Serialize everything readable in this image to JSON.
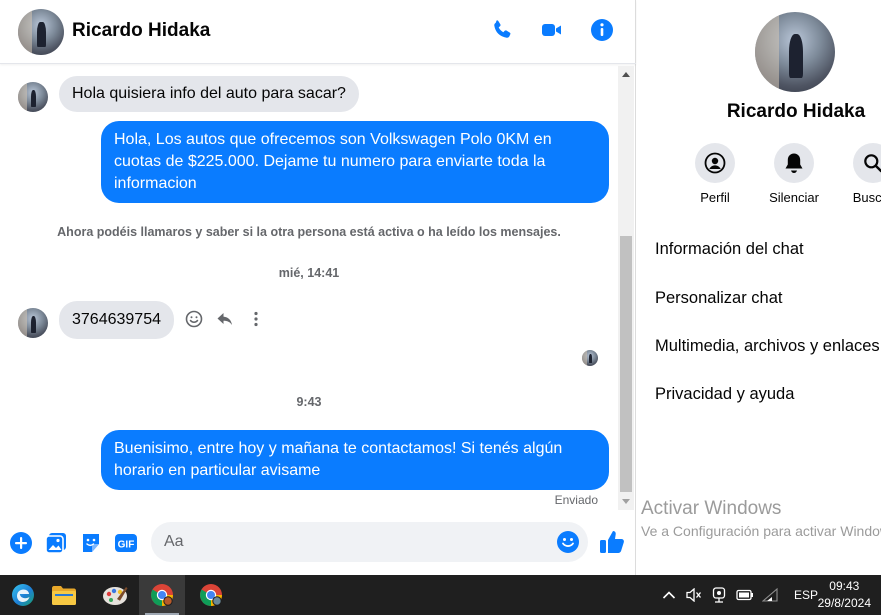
{
  "header": {
    "contact_name": "Ricardo Hidaka",
    "icons": [
      "phone-icon",
      "video-camera-icon",
      "info-icon"
    ]
  },
  "messages": {
    "incoming_1": "Hola quisiera info del auto para sacar?",
    "outgoing_1": "Hola, Los autos que ofrecemos son Volkswagen Polo 0KM en cuotas de $225.000. Dejame tu numero para enviarte toda la informacion",
    "system_notice": "Ahora podéis llamaros y saber si la otra persona está activa o ha leído los mensajes.",
    "timestamp_1": "mié, 14:41",
    "incoming_2": "3764639754",
    "timestamp_2": "9:43",
    "outgoing_2": "Buenisimo, entre hoy y mañana te contactamos! Si tenés algún horario en particular avisame",
    "status": "Enviado"
  },
  "composer": {
    "placeholder": "Aa",
    "icons": [
      "plus-icon",
      "image-icon",
      "sticker-icon",
      "gif-icon",
      "emoji-icon",
      "thumbs-up-icon"
    ],
    "gif_label": "GIF"
  },
  "panel": {
    "name": "Ricardo Hidaka",
    "buttons": [
      {
        "label": "Perfil",
        "icon": "profile-icon"
      },
      {
        "label": "Silenciar",
        "icon": "bell-icon"
      },
      {
        "label": "Buscar",
        "icon": "search-icon"
      }
    ],
    "items": [
      "Información del chat",
      "Personalizar chat",
      "Multimedia, archivos y enlaces",
      "Privacidad y ayuda"
    ],
    "watermark_title": "Activar Windows",
    "watermark_sub": "Ve a Configuración para activar Windows."
  },
  "taskbar": {
    "apps": [
      "windows-start-icon",
      "file-explorer-icon",
      "paint-icon",
      "chrome-icon",
      "chrome-profile-icon"
    ],
    "language": "ESP",
    "time": "09:43",
    "date": "29/8/2024"
  },
  "colors": {
    "accent": "#0a7cff",
    "incoming_bubble": "#e4e6eb",
    "taskbar": "#1f1f1f"
  }
}
